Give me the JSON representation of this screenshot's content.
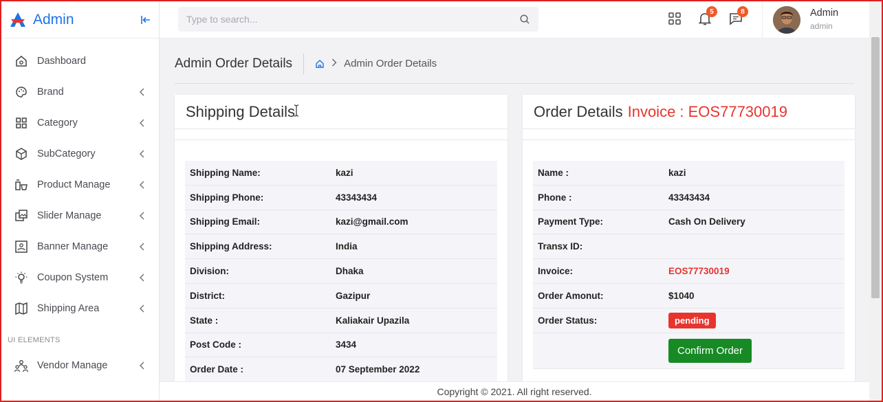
{
  "sidebar": {
    "brand": "Admin",
    "items": [
      {
        "label": "Dashboard",
        "icon": "home-icon"
      },
      {
        "label": "Brand",
        "icon": "palette-icon"
      },
      {
        "label": "Category",
        "icon": "grid-icon"
      },
      {
        "label": "SubCategory",
        "icon": "cube-icon"
      },
      {
        "label": "Product Manage",
        "icon": "products-icon"
      },
      {
        "label": "Slider Manage",
        "icon": "images-icon"
      },
      {
        "label": "Banner Manage",
        "icon": "image-icon"
      },
      {
        "label": "Coupon System",
        "icon": "bulb-icon"
      },
      {
        "label": "Shipping Area",
        "icon": "map-icon"
      }
    ],
    "section": "UI ELEMENTS",
    "section_items": [
      {
        "label": "Vendor Manage",
        "icon": "users-icon"
      }
    ]
  },
  "topbar": {
    "search_placeholder": "Type to search...",
    "notification_count": "5",
    "message_count": "8",
    "user_name": "Admin",
    "user_role": "admin"
  },
  "page": {
    "title": "Admin Order Details",
    "breadcrumb_current": "Admin Order Details"
  },
  "shipping": {
    "title": "Shipping Details",
    "rows": [
      {
        "label": "Shipping Name:",
        "value": "kazi"
      },
      {
        "label": "Shipping Phone:",
        "value": "43343434"
      },
      {
        "label": "Shipping Email:",
        "value": "kazi@gmail.com"
      },
      {
        "label": "Shipping Address:",
        "value": "India"
      },
      {
        "label": "Division:",
        "value": "Dhaka"
      },
      {
        "label": "District:",
        "value": "Gazipur"
      },
      {
        "label": "State :",
        "value": "Kaliakair Upazila"
      },
      {
        "label": "Post Code :",
        "value": "3434"
      },
      {
        "label": "Order Date :",
        "value": "07 September 2022"
      }
    ]
  },
  "order": {
    "title": "Order Details",
    "invoice_title": "Invoice : EOS77730019",
    "rows": [
      {
        "label": "Name :",
        "value": "kazi"
      },
      {
        "label": "Phone :",
        "value": "43343434"
      },
      {
        "label": "Payment Type:",
        "value": "Cash On Delivery"
      },
      {
        "label": "Transx ID:",
        "value": ""
      },
      {
        "label": "Invoice:",
        "value": "EOS77730019"
      },
      {
        "label": "Order Amonut:",
        "value": "$1040"
      }
    ],
    "status_label": "Order Status:",
    "status_value": "pending",
    "confirm_label": "Confirm Order"
  },
  "footer": {
    "text": "Copyright © 2021. All right reserved."
  },
  "colors": {
    "brand_blue": "#1e73e8",
    "accent_red": "#e8342e",
    "confirm_green": "#178a25",
    "badge_orange": "#f05a28"
  }
}
